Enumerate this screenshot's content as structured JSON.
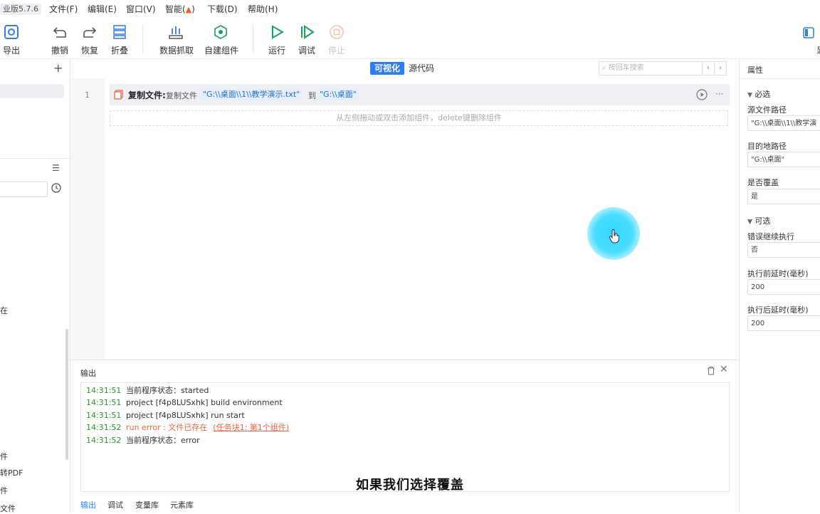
{
  "app": {
    "version_label": "业版5.7.6"
  },
  "menu": [
    "文件(F)",
    "编辑(E)",
    "窗口(V)",
    "智能(",
    ")",
    "下载(D)",
    "帮助(H)"
  ],
  "toolbar": {
    "export": "导出",
    "undo": "撤销",
    "redo": "恢复",
    "fold": "折叠",
    "data_capture": "数据抓取",
    "custom_component": "自建组件",
    "run": "运行",
    "debug": "调试",
    "stop": "停止",
    "right_cut": "显"
  },
  "left": {
    "items": [
      "在",
      "件",
      "转PDF",
      "件",
      "文件"
    ]
  },
  "editor": {
    "tab_visual": "可视化",
    "tab_source": "源代码",
    "search_placeholder": "按回车搜索",
    "prev": "‹",
    "next": "›",
    "line_number": "1",
    "step": {
      "title": "复制文件:",
      "action": "复制文件",
      "source": "\"G:\\\\桌面\\\\1\\\\教学演示.txt\"",
      "connector": "到",
      "dest": "\"G:\\\\桌面\""
    },
    "drop_hint": "从左侧拖动或双击添加组件，delete键删除组件"
  },
  "output": {
    "title": "输出",
    "logs": [
      {
        "time": "14:31:51",
        "text": "当前程序状态：started",
        "type": "info"
      },
      {
        "time": "14:31:51",
        "text": "project [f4p8LUSxhk] build environment",
        "type": "info"
      },
      {
        "time": "14:31:51",
        "text": "project [f4p8LUSxhk] run start",
        "type": "info"
      },
      {
        "time": "14:31:52",
        "text": "run error : 文件已存在",
        "link": "(任务块1: 第1个组件)",
        "type": "error"
      },
      {
        "time": "14:31:52",
        "text": "当前程序状态：error",
        "type": "info"
      }
    ],
    "subtitle": "如果我们选择覆盖",
    "tabs": [
      "输出",
      "调试",
      "变量库",
      "元素库"
    ]
  },
  "properties": {
    "title": "属性",
    "required": "必选",
    "source_label": "源文件路径",
    "source_value": "\"G:\\\\桌面\\\\1\\\\教学演",
    "dest_label": "目的地路径",
    "dest_value": "\"G:\\\\桌面\"",
    "overwrite_label": "是否覆盖",
    "overwrite_value": "是",
    "optional": "可选",
    "continue_label": "错误继续执行",
    "continue_value": "否",
    "pre_delay_label": "执行前延时(毫秒)",
    "pre_delay_value": "200",
    "post_delay_label": "执行后延时(毫秒)",
    "post_delay_value": "200"
  },
  "colors": {
    "accent": "#2f7cf6",
    "run": "#1aa260",
    "error": "#e8663d",
    "time": "#2f8f3a"
  }
}
